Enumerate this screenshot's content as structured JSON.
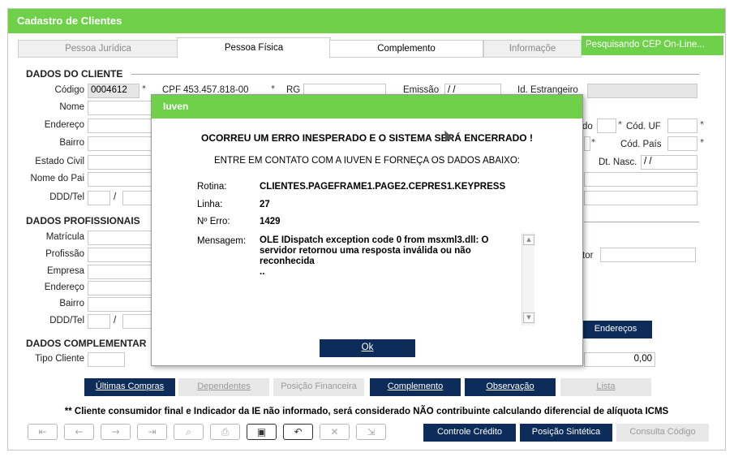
{
  "window": {
    "title": "Cadastro de Clientes"
  },
  "tabs": [
    {
      "label": "Pessoa Jurídica",
      "state": "disabled"
    },
    {
      "label": "Pessoa Física",
      "state": "active"
    },
    {
      "label": "Complemento",
      "state": "normal"
    },
    {
      "label": "Informaçõe",
      "state": "disabled"
    }
  ],
  "cep_status": "Pesquisando CEP On-Line...",
  "sections": {
    "cliente": "DADOS DO CLIENTE",
    "profissionais": "DADOS PROFISSIONAIS",
    "complementar": "DADOS COMPLEMENTAR"
  },
  "cliente": {
    "codigo_label": "Código",
    "codigo_value": "0004612",
    "cpf_label": "CPF",
    "cpf_value": "453.457.818-00",
    "rg_label": "RG",
    "emissao_label": "Emissão",
    "emissao_value": "/ /",
    "id_estrangeiro_label": "Id. Estrangeiro",
    "nome_label": "Nome",
    "endereco_label": "Endereço",
    "bairro_label": "Bairro",
    "estado_civil_label": "Estado Civil",
    "nome_pai_label": "Nome do Pai",
    "ddd_tel_label": "DDD/Tel",
    "slash": "/",
    "estado_label_fragment": "do",
    "cod_uf_label": "Cód. UF",
    "cod_pais_label": "Cód. País",
    "dt_nasc_label": "Dt. Nasc.",
    "dt_nasc_value": "/ /",
    "star": "*"
  },
  "profissionais": {
    "matricula_label": "Matrícula",
    "profissao_label": "Profissão",
    "empresa_label": "Empresa",
    "endereco_label": "Endereço",
    "bairro_label": "Bairro",
    "ddd_tel_label": "DDD/Tel",
    "slash": "/",
    "setor_fragment": "tor",
    "enderecos_button": "Endereços"
  },
  "complementar": {
    "tipo_cliente_label": "Tipo Cliente",
    "valor": "0,00"
  },
  "action_buttons": [
    {
      "label": "Últimas Compras",
      "enabled": true
    },
    {
      "label": "Dependentes",
      "enabled": false
    },
    {
      "label": "Posição Financeira",
      "enabled": false
    },
    {
      "label": "Complemento",
      "enabled": true
    },
    {
      "label": "Observação",
      "enabled": true
    },
    {
      "label": "Lista",
      "enabled": false
    }
  ],
  "notice": "** Cliente consumidor final e Indicador da IE não informado, será considerado NÃO contribuinte calculando diferencial de alíquota ICMS",
  "nav_buttons": [
    {
      "icon": "first-record-icon",
      "glyph": "⇤",
      "enabled": false
    },
    {
      "icon": "previous-record-icon",
      "glyph": "←",
      "enabled": false
    },
    {
      "icon": "next-record-icon",
      "glyph": "→",
      "enabled": false
    },
    {
      "icon": "last-record-icon",
      "glyph": "⇥",
      "enabled": false
    },
    {
      "icon": "search-icon",
      "glyph": "⌕",
      "enabled": false
    },
    {
      "icon": "print-icon",
      "glyph": "⎙",
      "enabled": false
    },
    {
      "icon": "save-icon",
      "glyph": "▣",
      "enabled": true
    },
    {
      "icon": "undo-icon",
      "glyph": "↶",
      "enabled": true
    },
    {
      "icon": "cancel-icon",
      "glyph": "✕",
      "enabled": false
    },
    {
      "icon": "exit-icon",
      "glyph": "⇲",
      "enabled": false
    }
  ],
  "bottom_buttons": [
    {
      "label": "Controle Crédito",
      "enabled": true
    },
    {
      "label": "Posição Sintética",
      "enabled": true
    },
    {
      "label": "Consulta Código",
      "enabled": false
    }
  ],
  "dialog": {
    "title": "Iuven",
    "heading": "OCORREU UM ERRO INESPERADO E O SISTEMA SERÁ ENCERRADO !",
    "subheading": "ENTRE EM CONTATO COM A IUVEN E FORNEÇA OS DADOS ABAIXO:",
    "rotina_label": "Rotina:",
    "rotina_value": "CLIENTES.PAGEFRAME1.PAGE2.CEPRES1.KEYPRESS",
    "linha_label": "Linha:",
    "linha_value": "27",
    "erro_label": "Nº Erro:",
    "erro_value": "1429",
    "mensagem_label": "Mensagem:",
    "mensagem_value": "OLE IDispatch exception code 0 from msxml3.dll: O servidor retornou uma resposta inválida ou não reconhecida\n..",
    "ok_label": "Ok"
  },
  "colors": {
    "green": "#6fd14a",
    "navy": "#0d2c5a"
  }
}
